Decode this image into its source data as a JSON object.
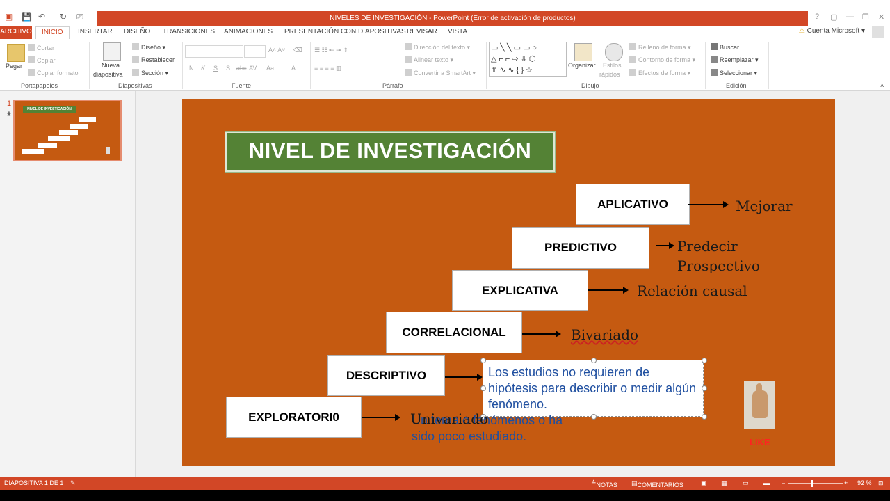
{
  "window": {
    "title": "NIVELES DE INVESTIGACIÓN -  PowerPoint (Error de activación de productos)",
    "controls": [
      "?",
      "▢",
      "—",
      "❐",
      "✕"
    ]
  },
  "tabs": [
    "ARCHIVO",
    "INICIO",
    "INSERTAR",
    "DISEÑO",
    "TRANSICIONES",
    "ANIMACIONES",
    "PRESENTACIÓN CON DIAPOSITIVAS",
    "REVISAR",
    "VISTA"
  ],
  "account": "Cuenta Microsoft",
  "ribbon": {
    "portapapeles": {
      "label": "Portapapeles",
      "pegar": "Pegar",
      "cortar": "Cortar",
      "copiar": "Copiar",
      "copiar_formato": "Copiar formato"
    },
    "diapositivas": {
      "label": "Diapositivas",
      "nueva1": "Nueva",
      "nueva2": "diapositiva",
      "diseno": "Diseño",
      "restablecer": "Restablecer",
      "seccion": "Sección"
    },
    "fuente": {
      "label": "Fuente",
      "buttons": [
        "N",
        "K",
        "S",
        "S",
        "abc",
        "AV",
        "Aa",
        "A"
      ]
    },
    "parrafo": {
      "label": "Párrafo",
      "direccion": "Dirección del texto",
      "alinear": "Alinear texto",
      "smartart": "Convertir a SmartArt"
    },
    "dibujo": {
      "label": "Dibujo",
      "organizar": "Organizar",
      "estilos1": "Estilos",
      "estilos2": "rápidos",
      "relleno": "Relleno de forma",
      "contorno": "Contorno de forma",
      "efectos": "Efectos de forma"
    },
    "edicion": {
      "label": "Edición",
      "buscar": "Buscar",
      "reemplazar": "Reemplazar",
      "seleccionar": "Seleccionar"
    }
  },
  "thumbnail": {
    "number": "1",
    "star": "★"
  },
  "slide": {
    "title": "NIVEL DE INVESTIGACIÓN",
    "steps": [
      {
        "label": "APLICATIVO",
        "note": "Mejorar"
      },
      {
        "label": "PREDICTIVO",
        "note": "Predecir",
        "note2": "Prospectivo"
      },
      {
        "label": "EXPLICATIVA",
        "note": "Relación causal"
      },
      {
        "label": "CORRELACIONAL",
        "note": "Bivariado"
      },
      {
        "label": "DESCRIPTIVO"
      },
      {
        "label": "EXPLORATORI0",
        "note": "Univariado"
      }
    ],
    "descriptivo_text": "Los estudios no requieren de hipótesis para describir o medir algún fenómeno.",
    "exploratorio_text_line1": "Un tema o fenómenos o ha",
    "exploratorio_text_line2": "sido poco estudiado.",
    "like": "LIKE"
  },
  "status": {
    "slide": "DIAPOSITIVA 1 DE 1",
    "notas": "NOTAS",
    "comentarios": "COMENTARIOS",
    "zoom": "92 %"
  }
}
